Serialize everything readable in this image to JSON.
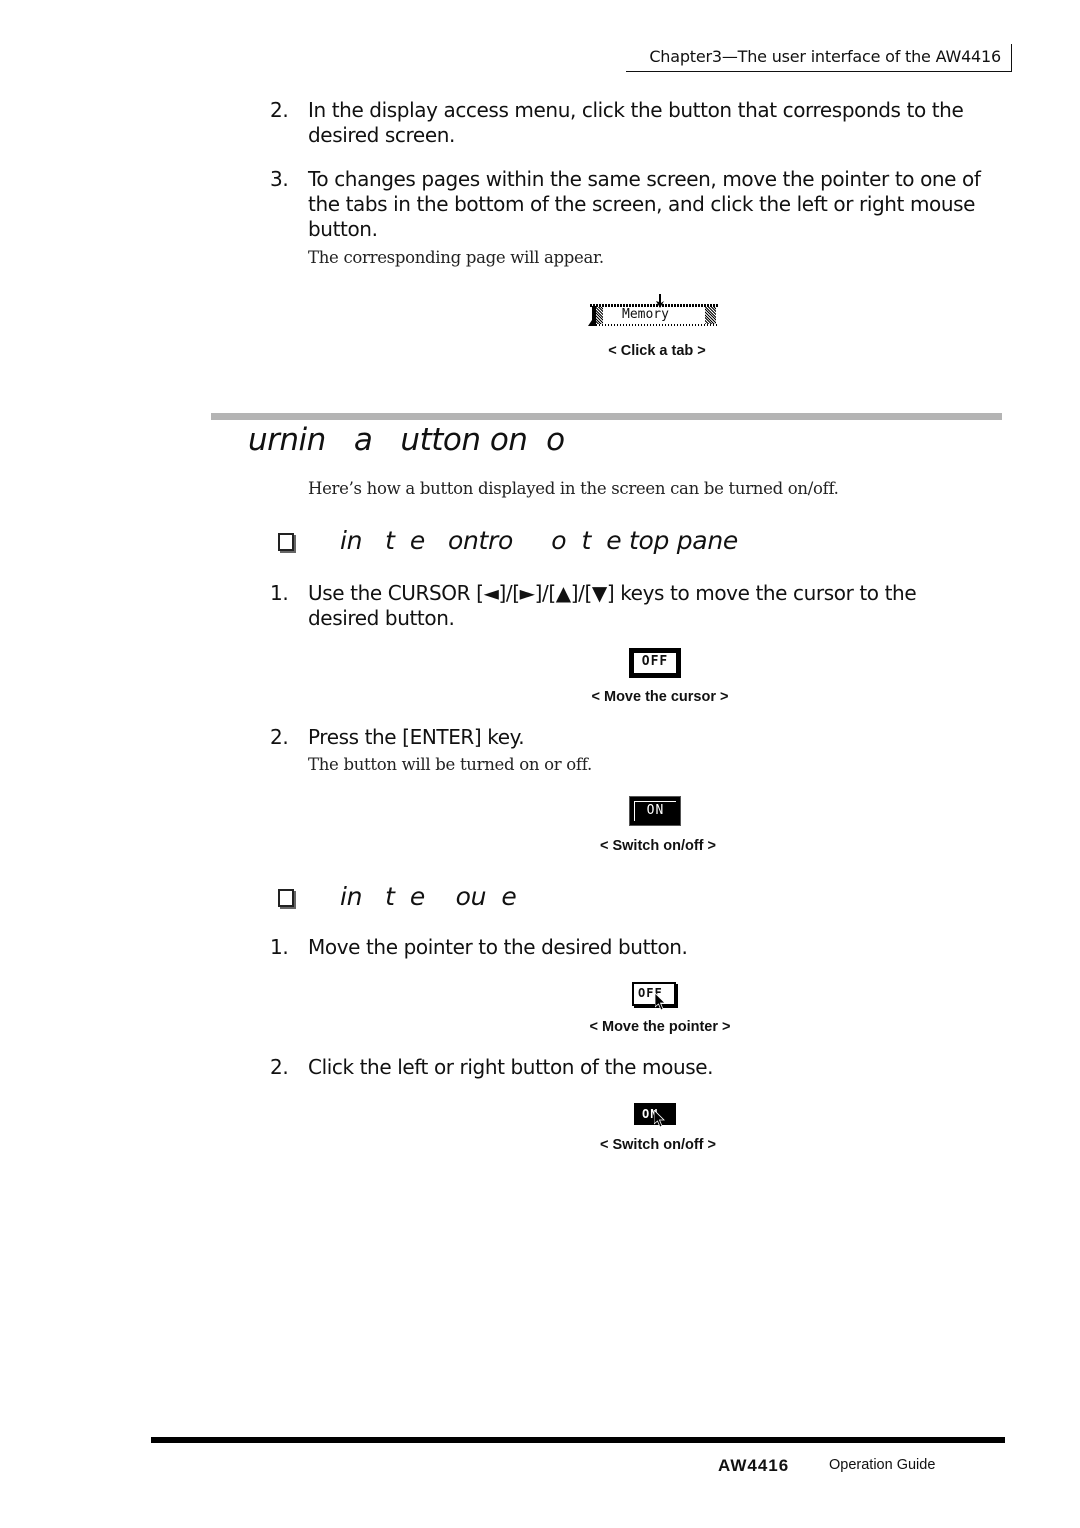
{
  "header": {
    "running_title": "Chapter3—The user interface of the AW4416"
  },
  "intro_steps": [
    {
      "num": "2.",
      "lines": [
        "In the display access menu, click the button that corresponds to the",
        "desired screen."
      ]
    },
    {
      "num": "3.",
      "lines": [
        "To changes pages within the same screen, move the pointer to one of",
        "the tabs in the bottom of the screen, and click the left or right mouse",
        "button."
      ]
    }
  ],
  "intro_note": "The corresponding page will appear.",
  "tab_figure": {
    "tab_label": "Memory",
    "caption": "< Click a tab >"
  },
  "section": {
    "title": "urnin   a   utton on  o",
    "description": "Here’s how a button displayed in the screen can be turned on/off."
  },
  "subsection_panel": {
    "title": "in   t  e   ontro     o  t  e top pane",
    "steps": [
      {
        "num": "1.",
        "lines": [
          "Use the CURSOR [◄]/[►]/[▲]/[▼] keys to move the cursor to the",
          "desired button."
        ]
      },
      {
        "num": "2.",
        "lines": [
          "Press the [ENTER] key."
        ]
      }
    ],
    "note": "The button will be turned on or off.",
    "figures": [
      {
        "button_label": "OFF",
        "caption": "< Move the cursor >"
      },
      {
        "button_label": "ON",
        "caption": "< Switch on/off >"
      }
    ]
  },
  "subsection_mouse": {
    "title": "in   t  e    ou  e",
    "steps": [
      {
        "num": "1.",
        "lines": [
          "Move the pointer to the desired button."
        ]
      },
      {
        "num": "2.",
        "lines": [
          "Click the left or right button of the mouse."
        ]
      }
    ],
    "figures": [
      {
        "button_label": "OFF",
        "caption": "< Move the pointer >"
      },
      {
        "button_label": "ON",
        "caption": "< Switch on/off >"
      }
    ]
  },
  "footer": {
    "model_logo": "AW4416",
    "guide_label": "Operation Guide"
  }
}
